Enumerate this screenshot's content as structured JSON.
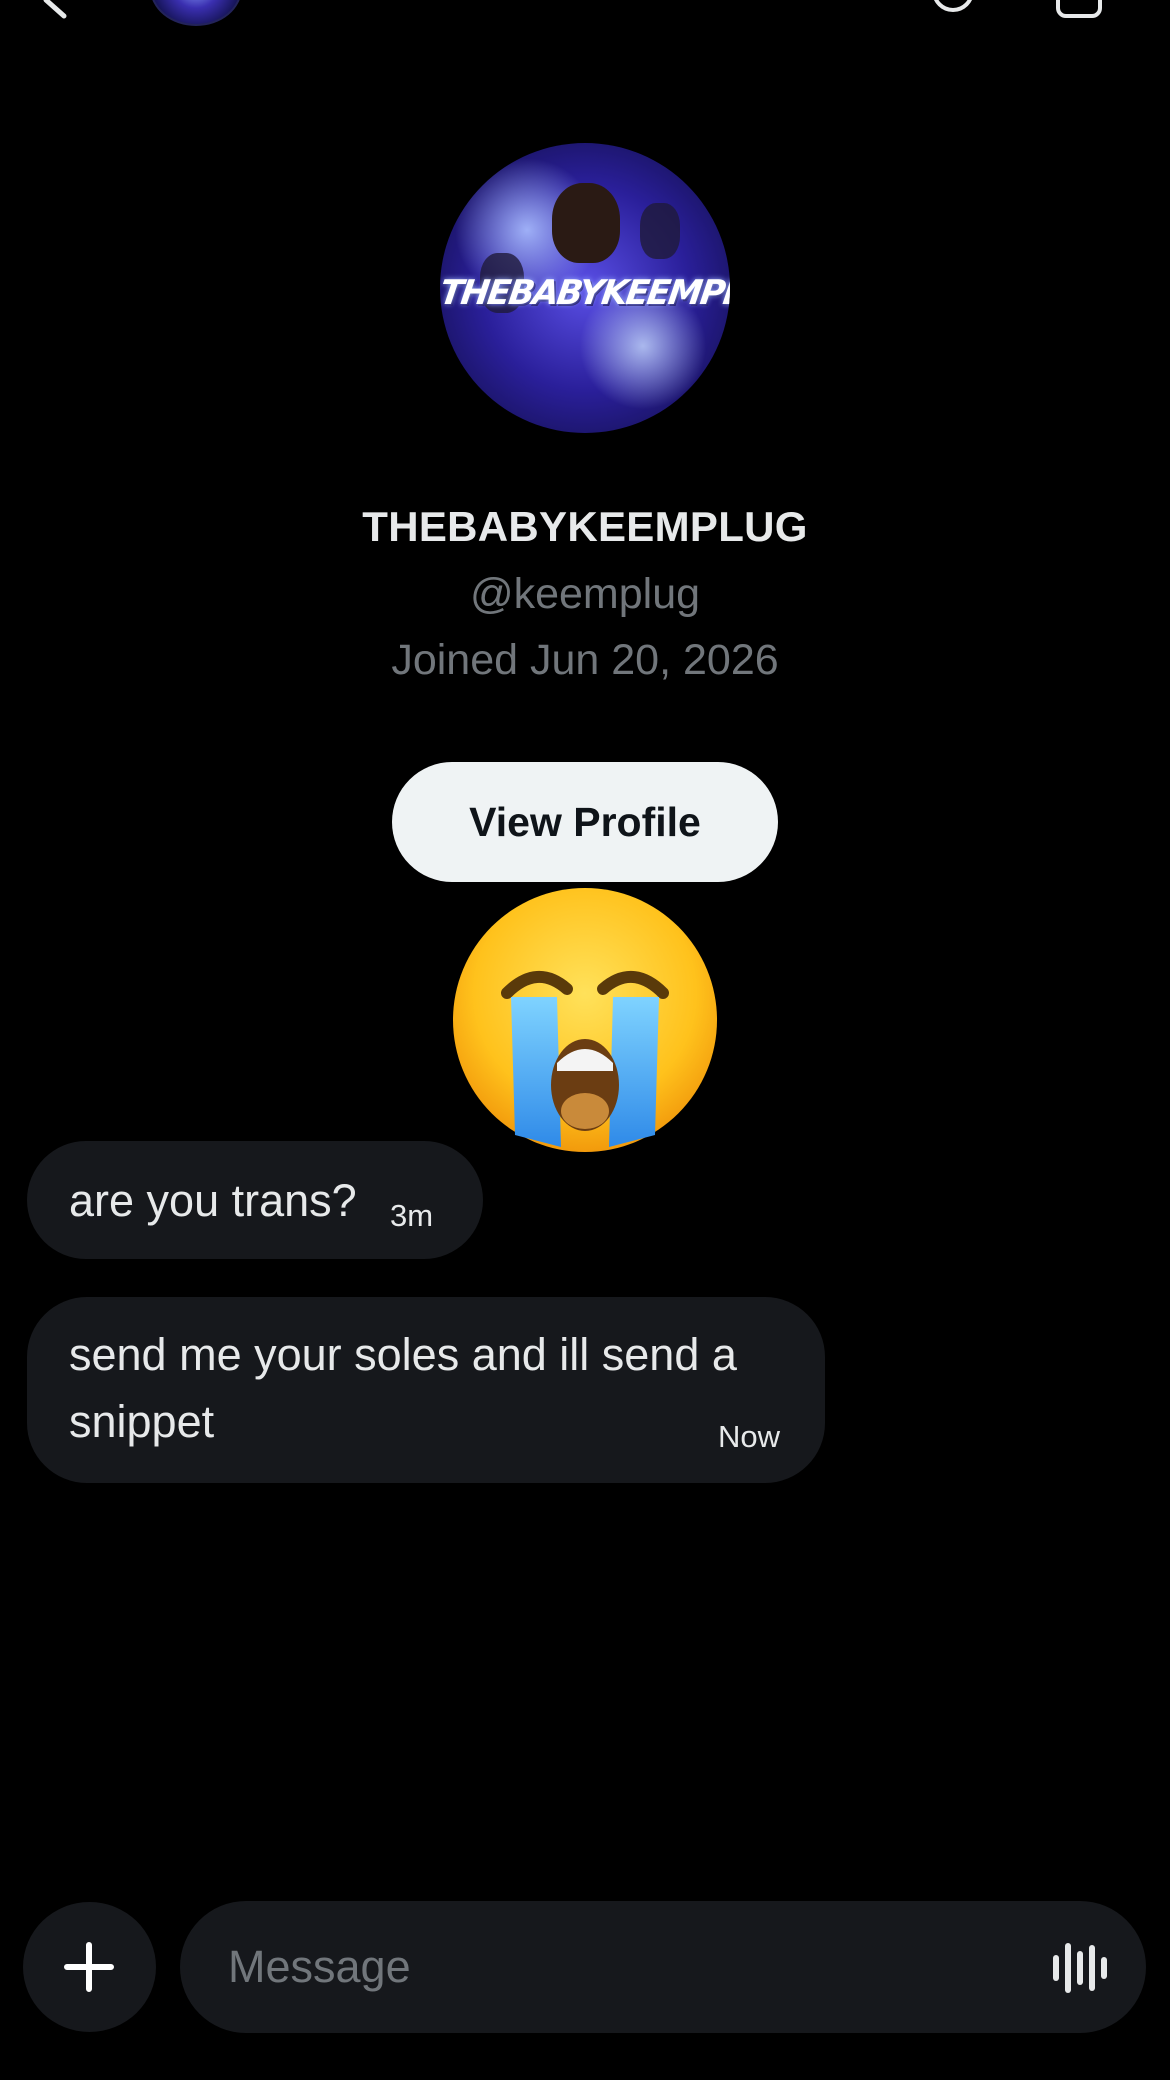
{
  "top_bar": {
    "back_icon": "back-arrow-icon",
    "avatar": "keemplug-avatar-small",
    "info_icon": "info-icon",
    "settings_icon": "settings-icon"
  },
  "profile": {
    "avatar_text": "THEBABYKEEMPLUG",
    "display_name": "THEBABYKEEMPLUG",
    "handle": "@keemplug",
    "joined": "Joined Jun 20, 2026",
    "view_profile_label": "View Profile"
  },
  "emoji": "loudly-crying-face",
  "messages": [
    {
      "text": "are you trans?",
      "time": "3m"
    },
    {
      "text": "send me your soles and ill send a snippet",
      "time": "Now"
    }
  ],
  "composer": {
    "attach_icon": "plus-icon",
    "placeholder": "Message",
    "voice_icon": "voice-waveform-icon"
  },
  "colors": {
    "background": "#000000",
    "bubble": "#16181c",
    "text_primary": "#e7e9ea",
    "text_secondary": "#71767b",
    "button_bg": "#eff3f4",
    "button_text": "#0f1419"
  }
}
